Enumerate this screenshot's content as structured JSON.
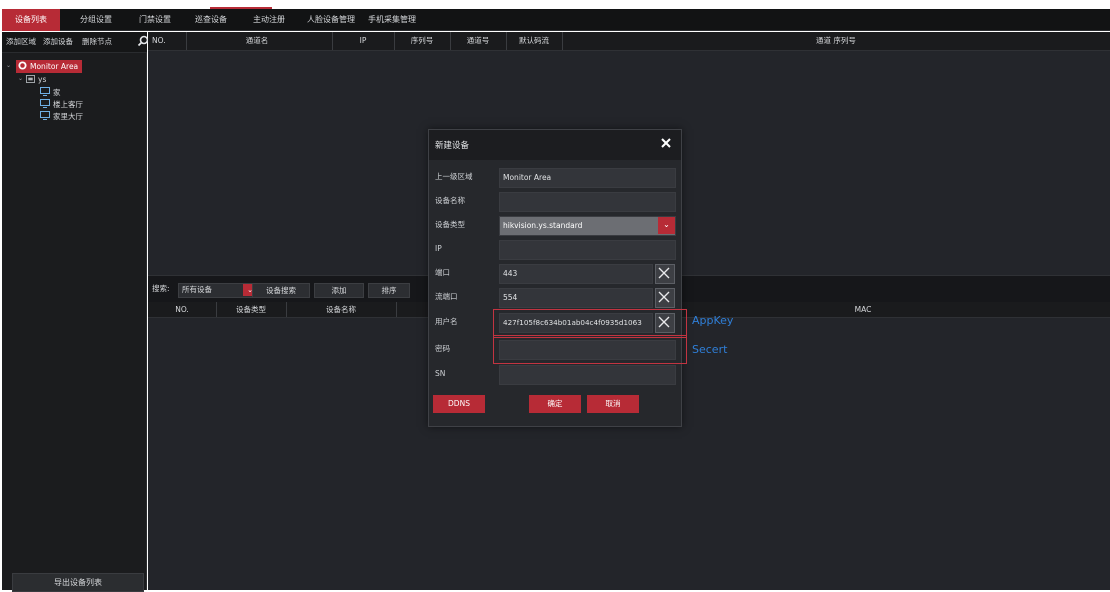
{
  "tabs": [
    {
      "label": "设备列表",
      "active": true
    },
    {
      "label": "分组设置",
      "active": false
    },
    {
      "label": "门禁设置",
      "active": false
    },
    {
      "label": "巡查设备",
      "active": false
    },
    {
      "label": "主动注册",
      "active": false
    },
    {
      "label": "人脸设备管理",
      "active": false
    },
    {
      "label": "手机采集管理",
      "active": false
    }
  ],
  "sidebar": {
    "tools": [
      "添加区域",
      "添加设备",
      "删除节点"
    ],
    "tree": {
      "root": "Monitor Area",
      "group": "ys",
      "devices": [
        "家",
        "楼上客厅",
        "家里大厅"
      ]
    },
    "export_label": "导出设备列表"
  },
  "channel_table": {
    "headers": [
      "NO.",
      "通道名",
      "IP",
      "序列号",
      "通道号",
      "默认码流",
      "通道 序列号"
    ]
  },
  "search_bar": {
    "label": "搜索:",
    "select_value": "所有设备",
    "buttons": [
      "设备搜索",
      "添加",
      "排序"
    ]
  },
  "device_table": {
    "headers": [
      "NO.",
      "设备类型",
      "设备名称",
      "MAC"
    ]
  },
  "dialog": {
    "title": "新建设备",
    "fields": {
      "parent": {
        "label": "上一级区域",
        "value": "Monitor Area"
      },
      "name": {
        "label": "设备名称",
        "value": ""
      },
      "type": {
        "label": "设备类型",
        "value": "hikvision.ys.standard"
      },
      "ip": {
        "label": "IP",
        "value": ""
      },
      "port": {
        "label": "端口",
        "value": "443"
      },
      "stream_port": {
        "label": "流端口",
        "value": "554"
      },
      "username": {
        "label": "用户名",
        "value": "427f105f8c634b01ab04c4f0935d1063"
      },
      "password": {
        "label": "密码",
        "value": ""
      },
      "sn": {
        "label": "SN",
        "value": ""
      }
    },
    "buttons": {
      "ddns": "DDNS",
      "ok": "确定",
      "cancel": "取消"
    }
  },
  "annotations": {
    "appkey": "AppKey",
    "secret": "Secert"
  },
  "colors": {
    "accent": "#b72b36",
    "annotation_box": "#c23441",
    "annotation_text": "#2f7fd8",
    "panel_bg": "#23252a"
  }
}
